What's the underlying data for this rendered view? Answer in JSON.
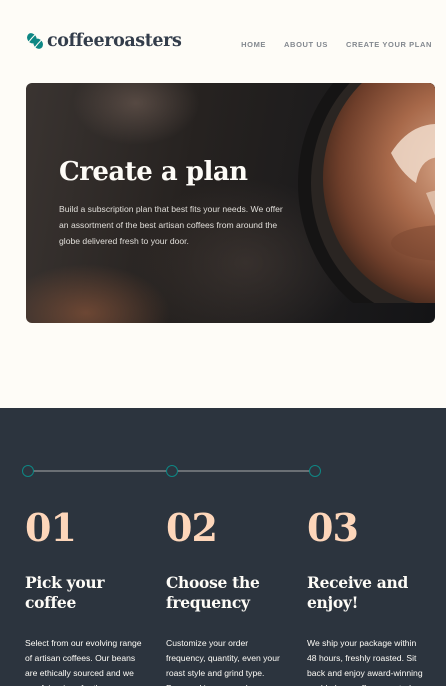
{
  "brand": {
    "name": "coffeeroasters",
    "icon": "coffee-bean-icon",
    "accent_color": "#0E8784"
  },
  "nav": {
    "items": [
      {
        "label": "HOME"
      },
      {
        "label": "ABOUT US"
      },
      {
        "label": "CREATE YOUR PLAN"
      }
    ]
  },
  "hero": {
    "title": "Create a plan",
    "description": "Build a subscription plan that best fits your needs. We offer an assortment of the best artisan coffees from around the globe delivered fresh to your door."
  },
  "how_it_works": {
    "background_color": "#2C343E",
    "number_color": "#FDD6BA",
    "steps": [
      {
        "number": "01",
        "title": "Pick your coffee",
        "description": "Select from our evolving range of artisan coffees. Our beans are ethically sourced and we pay fair prices for them."
      },
      {
        "number": "02",
        "title": "Choose the frequency",
        "description": "Customize your order frequency, quantity, even your roast style and grind type. Pause, skip or cancel."
      },
      {
        "number": "03",
        "title": "Receive and enjoy!",
        "description": "We ship your package within 48 hours, freshly roasted. Sit back and enjoy award-winning world-class coffees curated."
      }
    ]
  }
}
